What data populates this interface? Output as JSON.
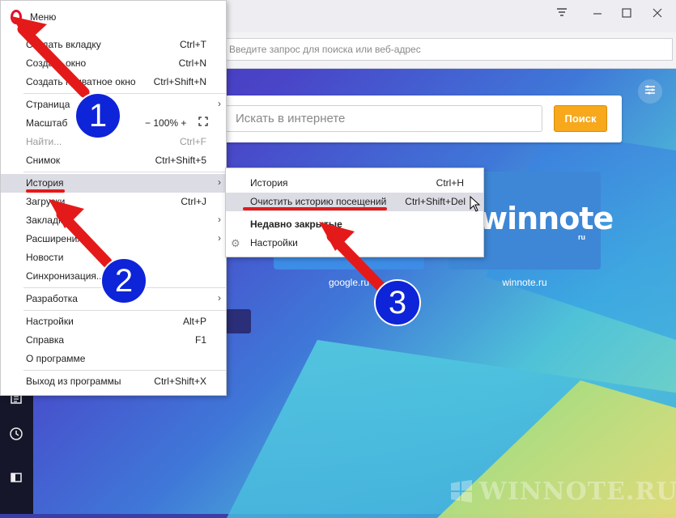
{
  "browser": {
    "address_placeholder": "Введите запрос для поиска или веб-адрес",
    "search_placeholder": "Искать в интернете",
    "search_button": "Поиск",
    "tiles": [
      {
        "label": "google.ru"
      },
      {
        "label": "winnote.ru",
        "logo_text": "winnote",
        "logo_sub": "ru"
      }
    ],
    "watermark": "WINNOTE.RU"
  },
  "menu": {
    "title": "Меню",
    "items": [
      {
        "label": "Создать вкладку",
        "shortcut": "Ctrl+T"
      },
      {
        "label": "Создать окно",
        "shortcut": "Ctrl+N"
      },
      {
        "label": "Создать приватное окно",
        "shortcut": "Ctrl+Shift+N"
      },
      {
        "label": "Страница",
        "shortcut": ""
      },
      {
        "label": "Масштаб",
        "shortcut": ""
      },
      {
        "label": "Найти...",
        "shortcut": "Ctrl+F"
      },
      {
        "label": "Снимок",
        "shortcut": "Ctrl+Shift+5"
      },
      {
        "label": "История",
        "shortcut": ""
      },
      {
        "label": "Загрузки",
        "shortcut": "Ctrl+J"
      },
      {
        "label": "Закладки",
        "shortcut": ""
      },
      {
        "label": "Расширения",
        "shortcut": ""
      },
      {
        "label": "Новости",
        "shortcut": ""
      },
      {
        "label": "Синхронизация...",
        "shortcut": ""
      },
      {
        "label": "Разработка",
        "shortcut": ""
      },
      {
        "label": "Настройки",
        "shortcut": "Alt+P"
      },
      {
        "label": "Справка",
        "shortcut": "F1"
      },
      {
        "label": "О программе",
        "shortcut": ""
      },
      {
        "label": "Выход из программы",
        "shortcut": "Ctrl+Shift+X"
      }
    ],
    "zoom": {
      "minus": "−",
      "value": "100%",
      "plus": "+"
    }
  },
  "submenu": {
    "items": [
      {
        "label": "История",
        "shortcut": "Ctrl+H"
      },
      {
        "label": "Очистить историю посещений",
        "shortcut": "Ctrl+Shift+Del"
      },
      {
        "label": "Недавно закрытые",
        "shortcut": ""
      },
      {
        "label": "Настройки",
        "shortcut": ""
      }
    ]
  },
  "annotations": {
    "badges": [
      "1",
      "2",
      "3"
    ],
    "accent_color": "#e41a1a",
    "badge_color": "#0d24d8"
  },
  "icons": {
    "window": [
      "filter-icon",
      "minimize-icon",
      "maximize-icon",
      "close-icon"
    ],
    "sidebar": [
      "news-icon",
      "history-icon",
      "sidebar-toggle-icon"
    ]
  }
}
